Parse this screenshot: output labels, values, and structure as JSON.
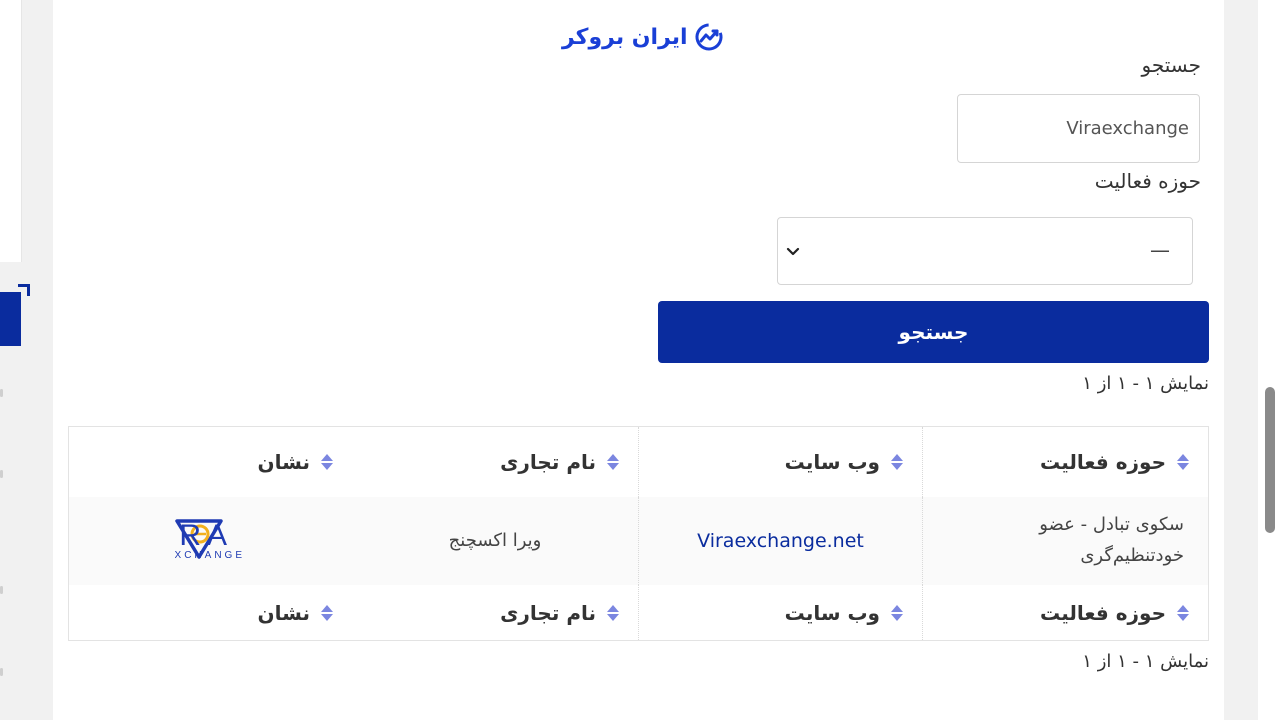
{
  "brand": {
    "logo_text": "ایران بروکر"
  },
  "search": {
    "label": "جستجو",
    "value": "Viraexchange"
  },
  "activity_filter": {
    "label": "حوزه فعالیت",
    "selected": "—"
  },
  "search_button": {
    "label": "جستجو"
  },
  "results_info": "نمایش ۱ - ۱ از ۱",
  "table": {
    "columns": [
      "حوزه فعالیت",
      "وب سایت",
      "نام تجاری",
      "نشان"
    ],
    "rows": [
      {
        "activity": "سکوی تبادل - عضو خودتنظیم‌گری",
        "website": "Viraexchange.net",
        "trade_name": "ویرا اکسچنج",
        "logo": {
          "word": "VIRA",
          "sub": "EXCHANGE"
        }
      }
    ]
  },
  "colors": {
    "primary": "#0a2c9e",
    "brand_blue": "#1a3fd6",
    "sort_icon": "#7b86e0",
    "vira_blue": "#1f3bb3",
    "vira_gold": "#f2b01e"
  }
}
